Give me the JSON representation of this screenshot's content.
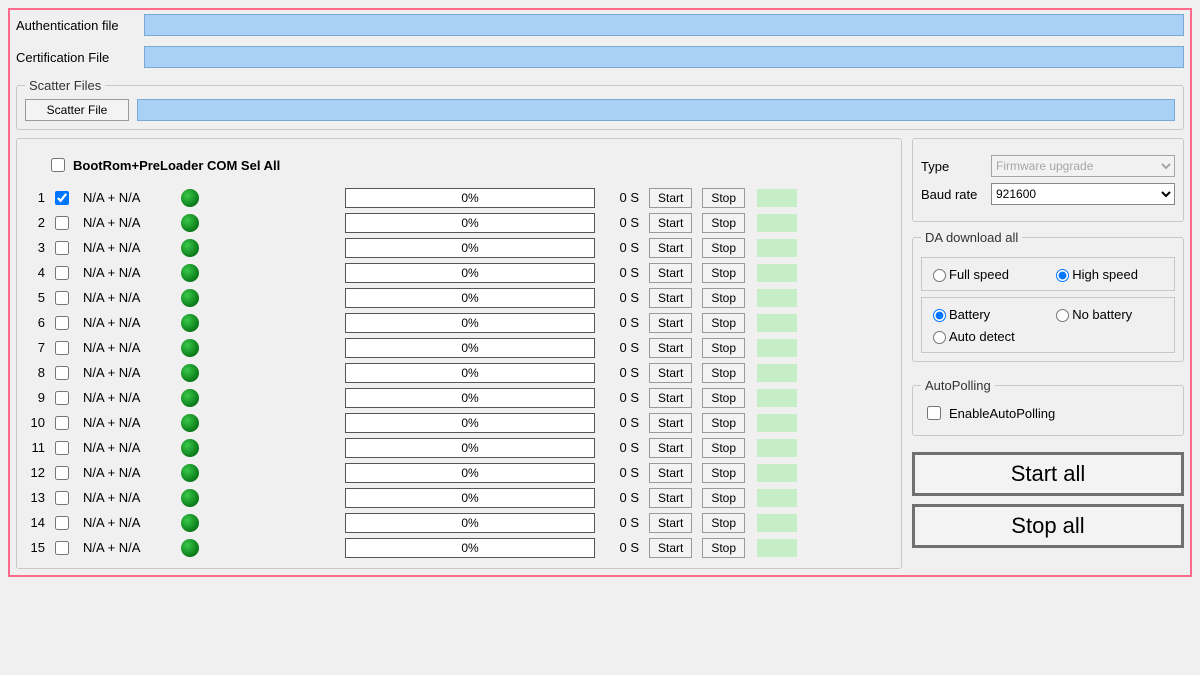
{
  "files": {
    "auth_label": "Authentication file",
    "cert_label": "Certification File",
    "scatter_legend": "Scatter Files",
    "scatter_button": "Scatter File"
  },
  "selall": {
    "label": "BootRom+PreLoader COM Sel All",
    "checked": false
  },
  "ports": [
    {
      "idx": "1",
      "checked": true,
      "label": "N/A + N/A",
      "progress": "0%",
      "time": "0 S"
    },
    {
      "idx": "2",
      "checked": false,
      "label": "N/A + N/A",
      "progress": "0%",
      "time": "0 S"
    },
    {
      "idx": "3",
      "checked": false,
      "label": "N/A + N/A",
      "progress": "0%",
      "time": "0 S"
    },
    {
      "idx": "4",
      "checked": false,
      "label": "N/A + N/A",
      "progress": "0%",
      "time": "0 S"
    },
    {
      "idx": "5",
      "checked": false,
      "label": "N/A + N/A",
      "progress": "0%",
      "time": "0 S"
    },
    {
      "idx": "6",
      "checked": false,
      "label": "N/A + N/A",
      "progress": "0%",
      "time": "0 S"
    },
    {
      "idx": "7",
      "checked": false,
      "label": "N/A + N/A",
      "progress": "0%",
      "time": "0 S"
    },
    {
      "idx": "8",
      "checked": false,
      "label": "N/A + N/A",
      "progress": "0%",
      "time": "0 S"
    },
    {
      "idx": "9",
      "checked": false,
      "label": "N/A + N/A",
      "progress": "0%",
      "time": "0 S"
    },
    {
      "idx": "10",
      "checked": false,
      "label": "N/A + N/A",
      "progress": "0%",
      "time": "0 S"
    },
    {
      "idx": "11",
      "checked": false,
      "label": "N/A + N/A",
      "progress": "0%",
      "time": "0 S"
    },
    {
      "idx": "12",
      "checked": false,
      "label": "N/A + N/A",
      "progress": "0%",
      "time": "0 S"
    },
    {
      "idx": "13",
      "checked": false,
      "label": "N/A + N/A",
      "progress": "0%",
      "time": "0 S"
    },
    {
      "idx": "14",
      "checked": false,
      "label": "N/A + N/A",
      "progress": "0%",
      "time": "0 S"
    },
    {
      "idx": "15",
      "checked": false,
      "label": "N/A + N/A",
      "progress": "0%",
      "time": "0 S"
    }
  ],
  "row_buttons": {
    "start": "Start",
    "stop": "Stop"
  },
  "right": {
    "type_label": "Type",
    "type_value": "Firmware upgrade",
    "baud_label": "Baud rate",
    "baud_value": "921600",
    "da_legend": "DA download all",
    "speed": {
      "full": "Full speed",
      "high": "High speed",
      "selected": "high"
    },
    "power": {
      "battery": "Battery",
      "nobattery": "No battery",
      "auto": "Auto detect",
      "selected": "battery"
    },
    "autopoll_legend": "AutoPolling",
    "autopoll_label": "EnableAutoPolling",
    "autopoll_checked": false,
    "start_all": "Start all",
    "stop_all": "Stop all"
  }
}
